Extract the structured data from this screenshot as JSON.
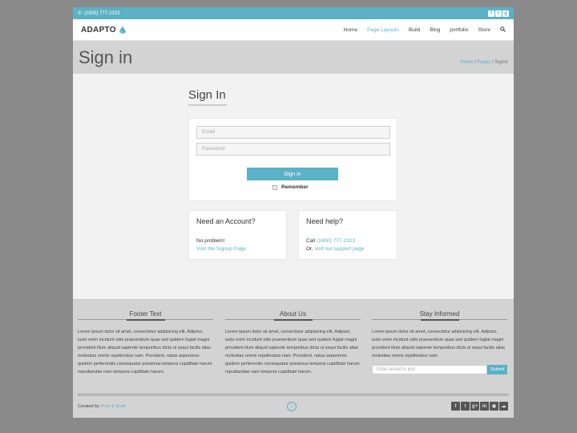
{
  "topbar": {
    "phone": "(1800) 777-2323",
    "social": [
      {
        "name": "facebook-icon",
        "glyph": "f"
      },
      {
        "name": "twitter-icon",
        "glyph": "t"
      },
      {
        "name": "google-plus-icon",
        "glyph": "g"
      }
    ]
  },
  "header": {
    "logo": "ADAPTO",
    "nav": [
      {
        "label": "Home",
        "active": false
      },
      {
        "label": "Page Layouts",
        "active": true
      },
      {
        "label": "Build",
        "active": false
      },
      {
        "label": "Blog",
        "active": false
      },
      {
        "label": "portfolio",
        "active": false
      },
      {
        "label": "Store",
        "active": false
      }
    ]
  },
  "titleband": {
    "title": "Sign in",
    "crumb_home": "Home",
    "crumb_sep": "/",
    "crumb_pages": "Pages",
    "crumb_current": "Signin"
  },
  "signin": {
    "heading": "Sign In",
    "email_placeholder": "Email",
    "password_placeholder": "Password",
    "button": "Sign in",
    "remember": "Remember"
  },
  "account": {
    "heading": "Need an Account?",
    "line1": "No problem!",
    "link": "Visit the Signup Page"
  },
  "help": {
    "heading": "Need help?",
    "call": "Call",
    "phone": "(1800) 777-2323",
    "or": "Or,",
    "link": "visit our support page"
  },
  "footer": {
    "col1_title": "Footer Text",
    "col1_text": "Lorem ipsum dolor sit amet, consectetur adipisicing elit. Adipisci, iusto enim incidunt odio praesentium quas sed quidem fugiat magni provident illum aliquid sapiente temporibus dicta ut sequi facilis alias molestias omnis repellendus nam. Provident, natus asperiores quidem perferendis consequatur possimus tempora cupiditate harum repudiandae nam tempora cupiditate harum.",
    "col2_title": "About Us",
    "col2_text": "Lorem ipsum dolor sit amet, consectetur adipisicing elit. Adipisci, iusto enim incidunt odio praesentium quas sed quidem fugiat magni provident illum aliquid sapiente temporibus dicta ut sequi facilis alias molestias omnis repellendus nam. Provident, natus asperiores quidem perferendis consequatur possimus tempora cupiditate harum repudiandae nam tempora cupiditate harum.",
    "col3_title": "Stay Informed",
    "col3_text": "Lorem ipsum dolor sit amet, consectetur adipisicing elit. Adipisci, iusto enim incidunt odio praesentium quas sed quidem fugiat magni provident illum aliquid sapiente temporibus dicta ut sequi facilis alias molestias omnis repellendus nam.",
    "email_placeholder": "Enter email to join",
    "submit": "Submit",
    "created_by": "Created by",
    "author": "Pixel & Snaft",
    "social": [
      {
        "name": "facebook-icon",
        "glyph": "f"
      },
      {
        "name": "twitter-icon",
        "glyph": "t"
      },
      {
        "name": "google-plus-icon",
        "glyph": "g+"
      },
      {
        "name": "linkedin-icon",
        "glyph": "in"
      },
      {
        "name": "github-icon",
        "glyph": "◉"
      },
      {
        "name": "soundcloud-icon",
        "glyph": "☁"
      }
    ]
  },
  "colors": {
    "accent": "#5bb1c6",
    "band": "#d3d3d3",
    "page_bg": "#f2f2f2",
    "outer_bg": "#8a8a8a"
  }
}
